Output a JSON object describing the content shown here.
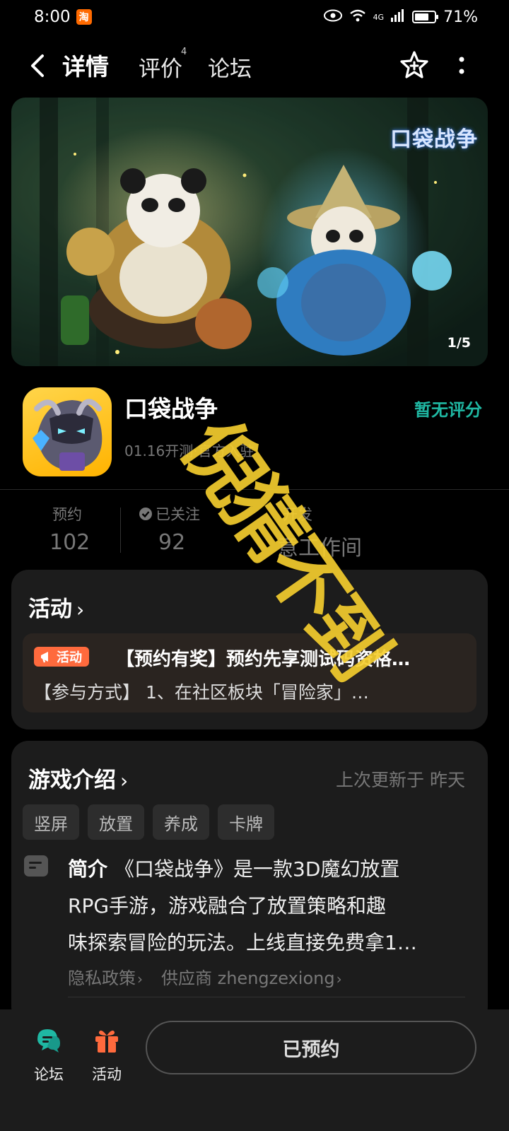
{
  "status_bar": {
    "time": "8:00",
    "app_badge": "淘",
    "network": "4G",
    "battery": "71%",
    "battery_level": 0.71
  },
  "nav": {
    "tabs": [
      "详情",
      "评价",
      "论坛"
    ],
    "review_count": "4"
  },
  "banner": {
    "counter": "1/5",
    "logo_text": "口袋战争"
  },
  "app": {
    "name": "口袋战争",
    "subtitle": "01.16开测·官方入驻",
    "rating": "暂无评分"
  },
  "stats": {
    "reserve_label": "预约",
    "reserve_value": "102",
    "follow_label": "已关注",
    "follow_value": "92",
    "dev_label": "开发",
    "dev_value": "意工作间"
  },
  "activity": {
    "title": "活动",
    "badge": "活动",
    "headline": "【预约有奖】预约先享测试码资格…",
    "detail": "【参与方式】 1、在社区板块「冒险家」…"
  },
  "intro": {
    "title": "游戏介绍",
    "updated": "上次更新于 昨天",
    "tags": [
      "竖屏",
      "放置",
      "养成",
      "卡牌"
    ],
    "summary_label": "简介",
    "summary_lines": [
      "《口袋战争》是一款3D魔幻放置",
      "RPG手游，游戏融合了放置策略和趣",
      "味探索冒险的玩法。上线直接免费拿1…"
    ],
    "privacy": "隐私政策",
    "supplier": "供应商 zhengzexiong"
  },
  "bottom": {
    "forum": "论坛",
    "activity": "活动",
    "reserved": "已预约"
  },
  "watermark": "倪猜不到",
  "colors": {
    "accent": "#1fb8a3",
    "orange": "#ff6a3d",
    "watermark": "#ffd630"
  }
}
